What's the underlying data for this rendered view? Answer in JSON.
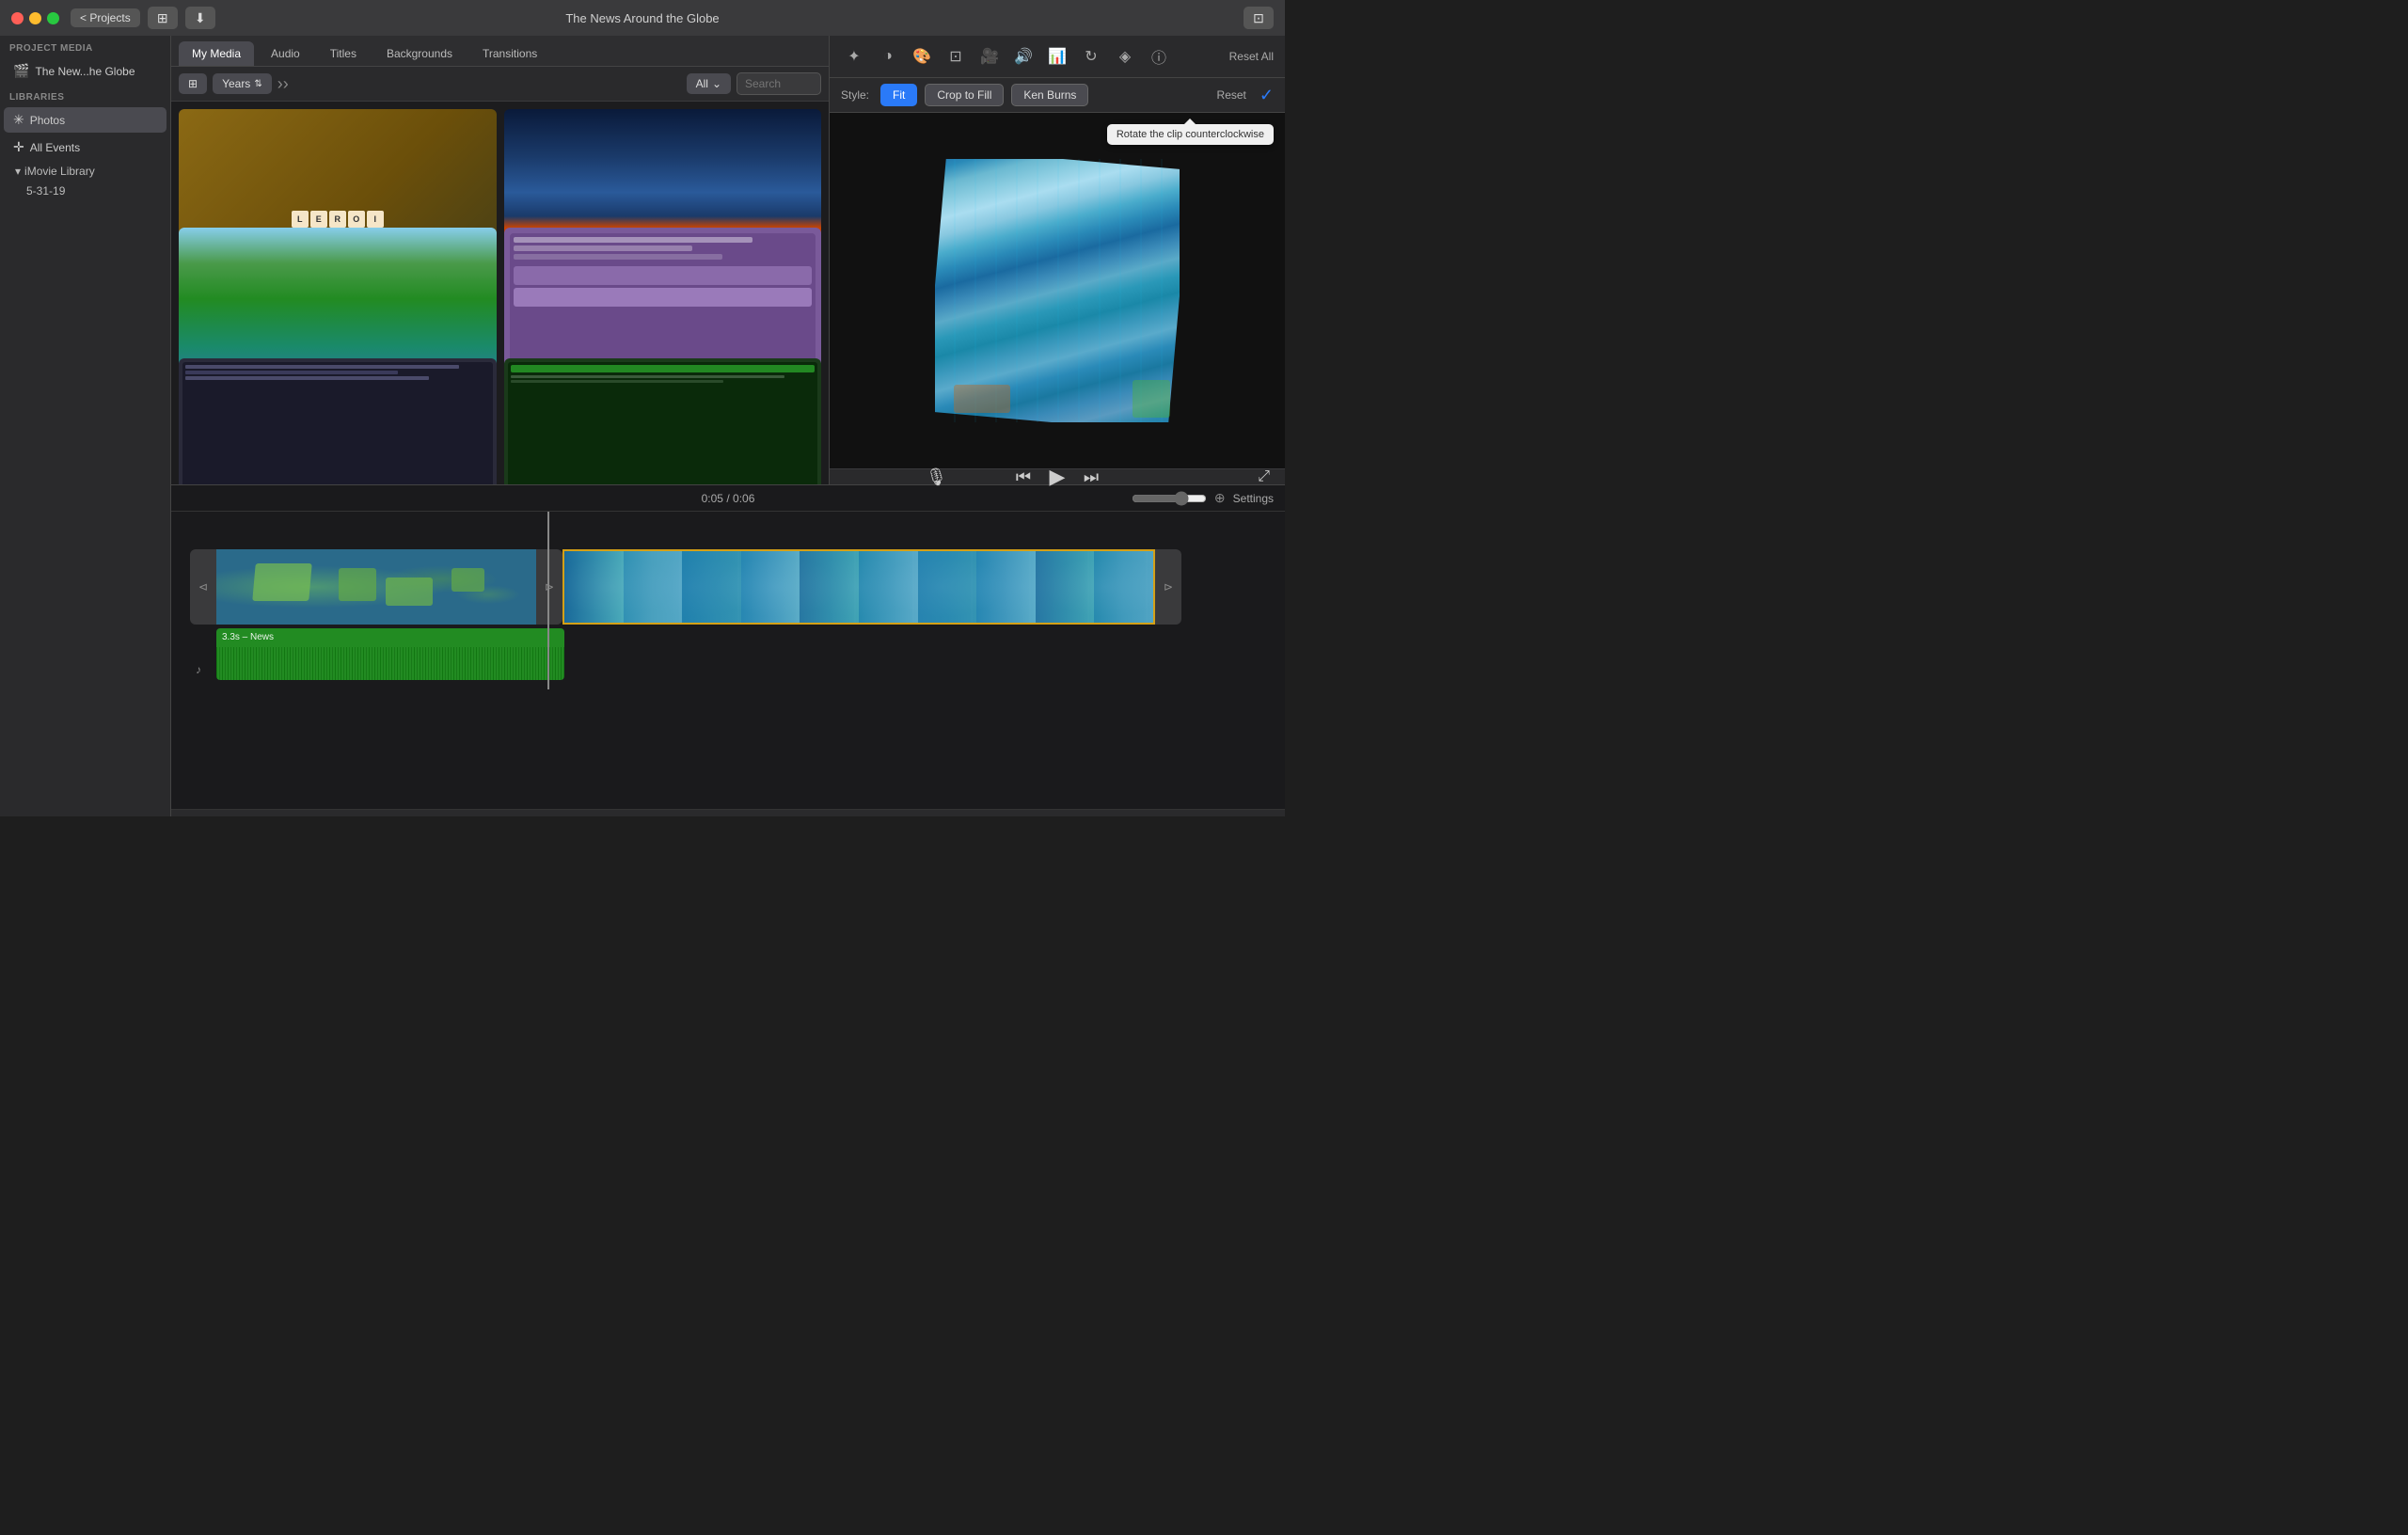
{
  "titlebar": {
    "title": "The News Around the Globe",
    "projects_btn": "< Projects",
    "download_icon": "⬇",
    "import_icon": "⊞"
  },
  "nav": {
    "tabs": [
      "My Media",
      "Audio",
      "Titles",
      "Backgrounds",
      "Transitions"
    ]
  },
  "media_toolbar": {
    "years_label": "Years",
    "filter_label": "All",
    "search_placeholder": "Search"
  },
  "preview": {
    "reset_all": "Reset All",
    "style_label": "Style:",
    "style_buttons": [
      "Fit",
      "Crop to Fill",
      "Ken Burns"
    ],
    "active_style": "Fit",
    "reset_btn": "Reset",
    "tooltip": "Rotate the clip counterclockwise"
  },
  "playback": {
    "time_current": "0:05",
    "time_total": "0:06",
    "separator": "/"
  },
  "timeline": {
    "settings_btn": "Settings",
    "clip1_label": "",
    "audio_label": "3.3s – News"
  },
  "sidebar": {
    "project_media_title": "PROJECT MEDIA",
    "project_name": "The New...he Globe",
    "libraries_title": "LIBRARIES",
    "photos_label": "Photos",
    "all_events_label": "All Events",
    "imovie_library_label": "iMovie Library",
    "date_label": "5-31-19"
  },
  "icons": {
    "mic": "🎙",
    "skip_back": "⏮",
    "play": "▶",
    "skip_fwd": "⏭",
    "fullscreen": "⤢",
    "zoom_in": "⊕"
  }
}
